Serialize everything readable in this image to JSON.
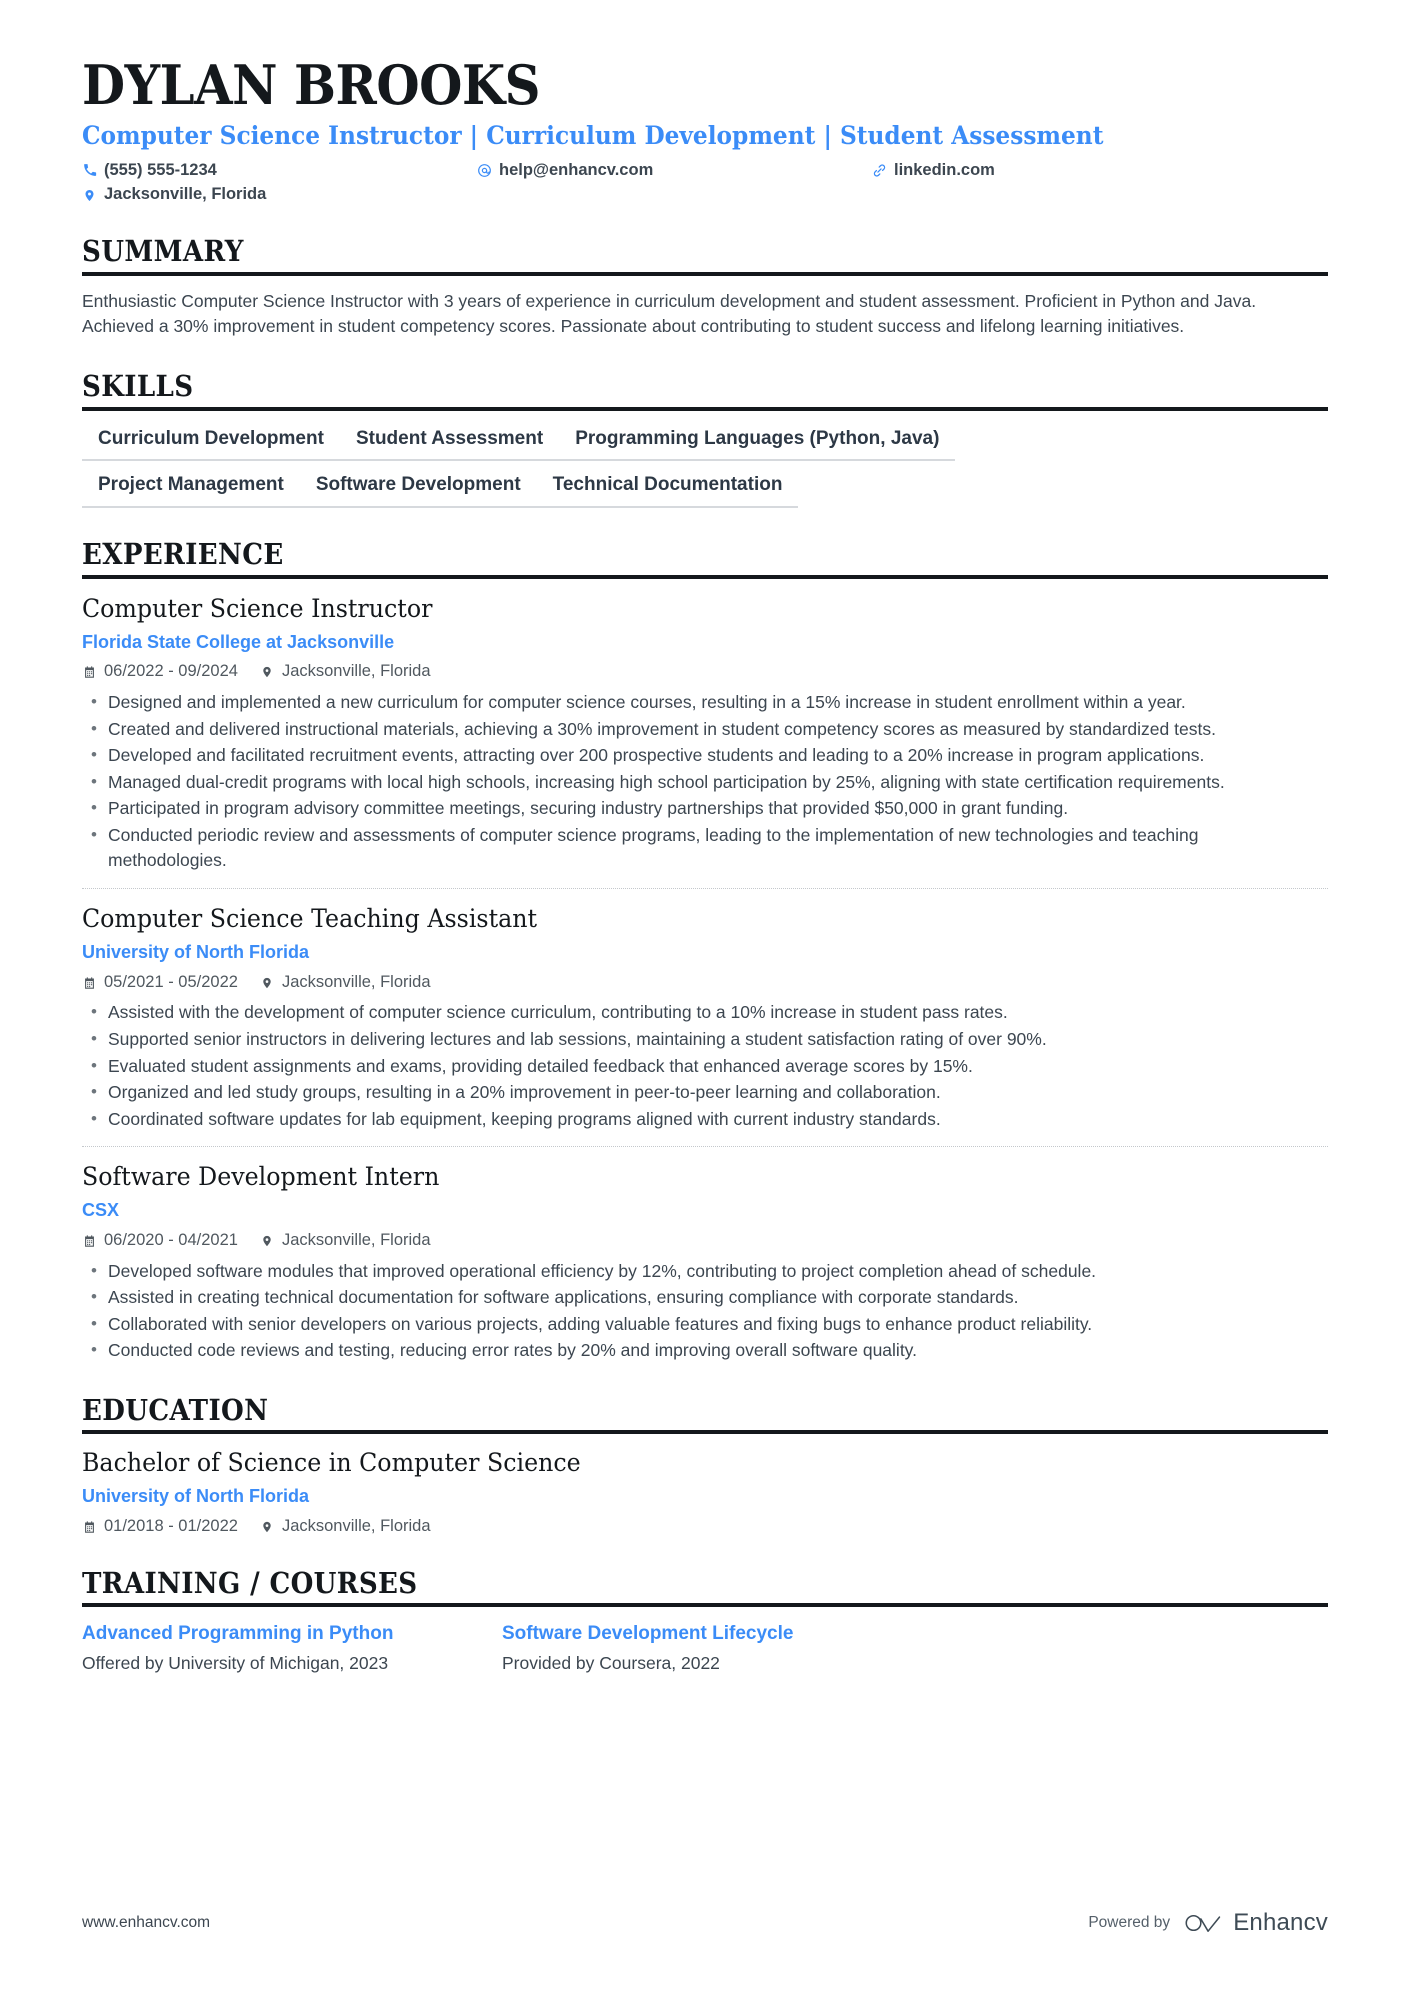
{
  "header": {
    "name": "DYLAN BROOKS",
    "headline": "Computer Science Instructor | Curriculum Development | Student Assessment",
    "phone": "(555) 555-1234",
    "email": "help@enhancv.com",
    "linkedin": "linkedin.com",
    "location": "Jacksonville, Florida",
    "accent_color": "#3b8cf7"
  },
  "sections": {
    "summary_title": "SUMMARY",
    "skills_title": "SKILLS",
    "experience_title": "EXPERIENCE",
    "education_title": "EDUCATION",
    "training_title": "TRAINING / COURSES"
  },
  "summary": {
    "text": "Enthusiastic Computer Science Instructor with 3 years of experience in curriculum development and student assessment. Proficient in Python and Java. Achieved a 30% improvement in student competency scores. Passionate about contributing to student success and lifelong learning initiatives."
  },
  "skills": {
    "row1": [
      "Curriculum Development",
      "Student Assessment",
      "Programming Languages (Python, Java)"
    ],
    "row2": [
      "Project Management",
      "Software Development",
      "Technical Documentation"
    ]
  },
  "experience": [
    {
      "title": "Computer Science Instructor",
      "org": "Florida State College at Jacksonville",
      "dates": "06/2022 - 09/2024",
      "location": "Jacksonville, Florida",
      "bullets": [
        "Designed and implemented a new curriculum for computer science courses, resulting in a 15% increase in student enrollment within a year.",
        "Created and delivered instructional materials, achieving a 30% improvement in student competency scores as measured by standardized tests.",
        "Developed and facilitated recruitment events, attracting over 200 prospective students and leading to a 20% increase in program applications.",
        "Managed dual-credit programs with local high schools, increasing high school participation by 25%, aligning with state certification requirements.",
        "Participated in program advisory committee meetings, securing industry partnerships that provided $50,000 in grant funding.",
        "Conducted periodic review and assessments of computer science programs, leading to the implementation of new technologies and teaching methodologies."
      ]
    },
    {
      "title": "Computer Science Teaching Assistant",
      "org": "University of North Florida",
      "dates": "05/2021 - 05/2022",
      "location": "Jacksonville, Florida",
      "bullets": [
        "Assisted with the development of computer science curriculum, contributing to a 10% increase in student pass rates.",
        "Supported senior instructors in delivering lectures and lab sessions, maintaining a student satisfaction rating of over 90%.",
        "Evaluated student assignments and exams, providing detailed feedback that enhanced average scores by 15%.",
        "Organized and led study groups, resulting in a 20% improvement in peer-to-peer learning and collaboration.",
        "Coordinated software updates for lab equipment, keeping programs aligned with current industry standards."
      ]
    },
    {
      "title": "Software Development Intern",
      "org": "CSX",
      "dates": "06/2020 - 04/2021",
      "location": "Jacksonville, Florida",
      "bullets": [
        "Developed software modules that improved operational efficiency by 12%, contributing to project completion ahead of schedule.",
        "Assisted in creating technical documentation for software applications, ensuring compliance with corporate standards.",
        "Collaborated with senior developers on various projects, adding valuable features and fixing bugs to enhance product reliability.",
        "Conducted code reviews and testing, reducing error rates by 20% and improving overall software quality."
      ]
    }
  ],
  "education": [
    {
      "degree": "Bachelor of Science in Computer Science",
      "school": "University of North Florida",
      "dates": "01/2018 - 01/2022",
      "location": "Jacksonville, Florida"
    }
  ],
  "training": [
    {
      "name": "Advanced Programming in Python",
      "sub": "Offered by University of Michigan, 2023"
    },
    {
      "name": "Software Development Lifecycle",
      "sub": "Provided by Coursera, 2022"
    }
  ],
  "footer": {
    "url": "www.enhancv.com",
    "powered_by": "Powered by",
    "brand": "Enhancv"
  }
}
